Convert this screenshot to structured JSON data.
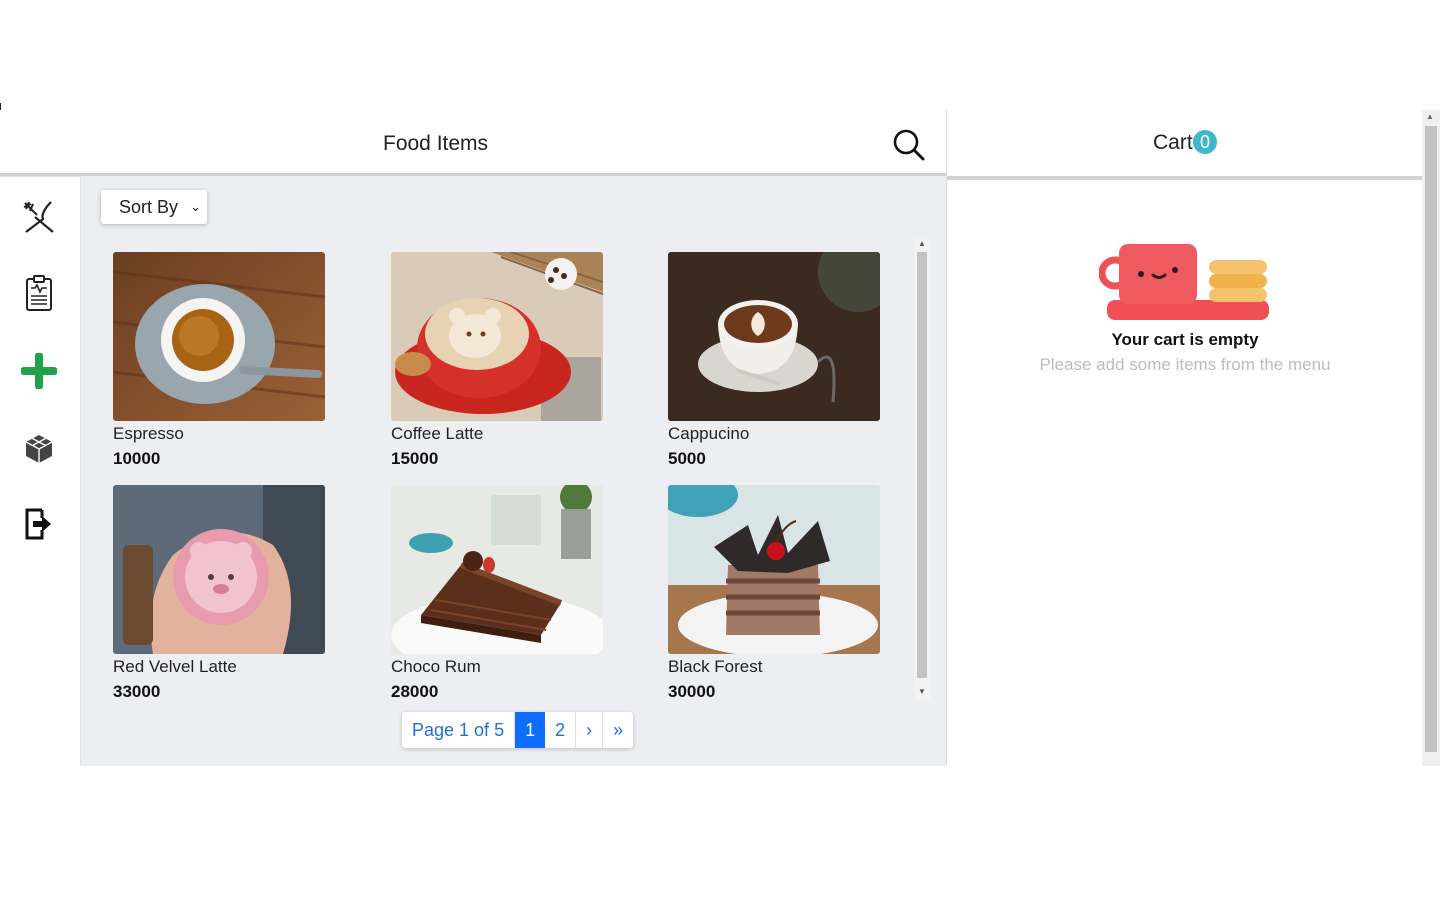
{
  "header": {
    "title": "Food Items"
  },
  "sidebar": {
    "items": [
      {
        "icon": "utensils-icon"
      },
      {
        "icon": "report-icon"
      },
      {
        "icon": "add-icon",
        "color": "#1fa34a"
      },
      {
        "icon": "boxes-icon"
      },
      {
        "icon": "logout-icon"
      }
    ]
  },
  "toolbar": {
    "sort_label": "Sort By"
  },
  "products": [
    {
      "name": "Espresso",
      "price": "10000"
    },
    {
      "name": "Coffee Latte",
      "price": "15000"
    },
    {
      "name": "Cappucino",
      "price": "5000"
    },
    {
      "name": "Red Velvel Latte",
      "price": "33000"
    },
    {
      "name": "Choco Rum",
      "price": "28000"
    },
    {
      "name": "Black Forest",
      "price": "30000"
    }
  ],
  "pagination": {
    "info": "Page 1 of 5",
    "pages": [
      "1",
      "2"
    ],
    "next": "›",
    "last": "»"
  },
  "cart": {
    "title": "Cart",
    "count": "0",
    "empty_title": "Your cart is empty",
    "empty_subtitle": "Please add some items from the menu"
  },
  "colors": {
    "accent": "#0d6efd",
    "badge": "#3fb6c9",
    "panel_bg": "#eceef1"
  }
}
